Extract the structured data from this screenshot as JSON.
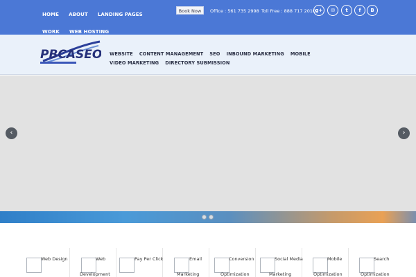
{
  "topbar": {
    "nav": [
      "HOME",
      "ABOUT",
      "LANDING PAGES",
      "WORK",
      "WEB HOSTING"
    ],
    "book_label": "Book Now",
    "office": "Office : 561 735 2998",
    "tollfree": "Toll Free : 888 717 2010",
    "social": [
      {
        "icon": "google-plus-icon",
        "glyph": "g+"
      },
      {
        "icon": "mail-icon",
        "glyph": "✉"
      },
      {
        "icon": "twitter-icon",
        "glyph": "t"
      },
      {
        "icon": "facebook-icon",
        "glyph": "f"
      },
      {
        "icon": "blogger-icon",
        "glyph": "B"
      }
    ],
    "color": "#4b78d6"
  },
  "header": {
    "logo_text": "PBCASEO",
    "nav": [
      "WEBSITE",
      "CONTENT MANAGEMENT",
      "SEO",
      "INBOUND MARKETING",
      "MOBILE",
      "VIDEO MARKETING",
      "DIRECTORY SUBMISSION"
    ]
  },
  "slider": {
    "prev_glyph": "‹",
    "next_glyph": "›",
    "dots": 2
  },
  "services": [
    {
      "line1": "Web Design",
      "line2": ""
    },
    {
      "line1": "Web",
      "line2": "Development"
    },
    {
      "line1": "Pay Per Click",
      "line2": ""
    },
    {
      "line1": "Email",
      "line2": "Marketing"
    },
    {
      "line1": "Conversion",
      "line2": "Optimization"
    },
    {
      "line1": "Social Media",
      "line2": "Marketing"
    },
    {
      "line1": "Mobile",
      "line2": "Optimization"
    },
    {
      "line1": "Search",
      "line2": "Optimization"
    }
  ]
}
